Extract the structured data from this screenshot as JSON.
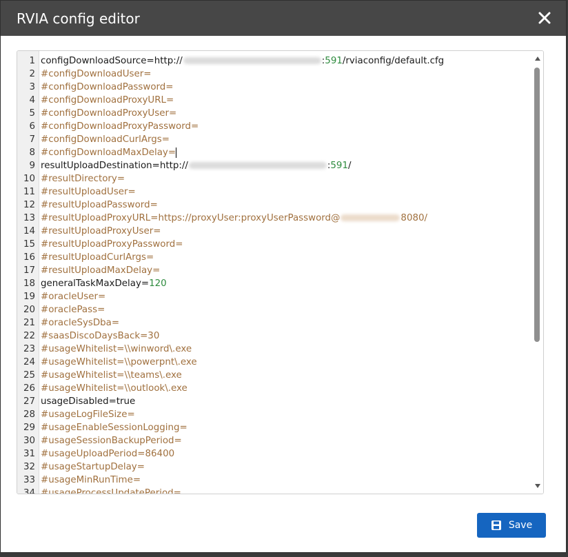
{
  "dialog": {
    "title": "RVIA config editor",
    "close_icon": "close-icon",
    "save_label": "Save",
    "save_icon": "floppy-disk-icon",
    "accent_color": "#1565c0"
  },
  "editor": {
    "lines": [
      {
        "n": "1",
        "parts": [
          {
            "t": "configDownloadSource=http://",
            "c": "plain"
          },
          {
            "t": "",
            "c": "blur"
          },
          {
            "t": ":",
            "c": "plain"
          },
          {
            "t": "591",
            "c": "num"
          },
          {
            "t": "/rviaconfig/default.cfg",
            "c": "plain"
          }
        ]
      },
      {
        "n": "2",
        "parts": [
          {
            "t": "#configDownloadUser=",
            "c": "comment"
          }
        ]
      },
      {
        "n": "3",
        "parts": [
          {
            "t": "#configDownloadPassword=",
            "c": "comment"
          }
        ]
      },
      {
        "n": "4",
        "parts": [
          {
            "t": "#configDownloadProxyURL=",
            "c": "comment"
          }
        ]
      },
      {
        "n": "5",
        "parts": [
          {
            "t": "#configDownloadProxyUser=",
            "c": "comment"
          }
        ]
      },
      {
        "n": "6",
        "parts": [
          {
            "t": "#configDownloadProxyPassword=",
            "c": "comment"
          }
        ]
      },
      {
        "n": "7",
        "parts": [
          {
            "t": "#configDownloadCurlArgs=",
            "c": "comment"
          }
        ]
      },
      {
        "n": "8",
        "parts": [
          {
            "t": "#configDownloadMaxDelay=",
            "c": "comment"
          },
          {
            "t": "",
            "c": "cursor"
          }
        ]
      },
      {
        "n": "9",
        "parts": [
          {
            "t": "resultUploadDestination=http://",
            "c": "plain"
          },
          {
            "t": "",
            "c": "blur"
          },
          {
            "t": ":",
            "c": "plain"
          },
          {
            "t": "591",
            "c": "num"
          },
          {
            "t": "/",
            "c": "plain"
          }
        ]
      },
      {
        "n": "10",
        "parts": [
          {
            "t": "#resultDirectory=",
            "c": "comment"
          }
        ]
      },
      {
        "n": "11",
        "parts": [
          {
            "t": "#resultUploadUser=",
            "c": "comment"
          }
        ]
      },
      {
        "n": "12",
        "parts": [
          {
            "t": "#resultUploadPassword=",
            "c": "comment"
          }
        ]
      },
      {
        "n": "13",
        "parts": [
          {
            "t": "#resultUploadProxyURL=https://proxyUser:proxyUserPassword@",
            "c": "comment"
          },
          {
            "t": "",
            "c": "blur-short"
          },
          {
            "t": "8080/",
            "c": "comment"
          }
        ]
      },
      {
        "n": "14",
        "parts": [
          {
            "t": "#resultUploadProxyUser=",
            "c": "comment"
          }
        ]
      },
      {
        "n": "15",
        "parts": [
          {
            "t": "#resultUploadProxyPassword=",
            "c": "comment"
          }
        ]
      },
      {
        "n": "16",
        "parts": [
          {
            "t": "#resultUploadCurlArgs=",
            "c": "comment"
          }
        ]
      },
      {
        "n": "17",
        "parts": [
          {
            "t": "#resultUploadMaxDelay=",
            "c": "comment"
          }
        ]
      },
      {
        "n": "18",
        "parts": [
          {
            "t": "generalTaskMaxDelay=",
            "c": "plain"
          },
          {
            "t": "120",
            "c": "num"
          }
        ]
      },
      {
        "n": "19",
        "parts": [
          {
            "t": "#oracleUser=",
            "c": "comment"
          }
        ]
      },
      {
        "n": "20",
        "parts": [
          {
            "t": "#oraclePass=",
            "c": "comment"
          }
        ]
      },
      {
        "n": "21",
        "parts": [
          {
            "t": "#oracleSysDba=",
            "c": "comment"
          }
        ]
      },
      {
        "n": "22",
        "parts": [
          {
            "t": "#saasDiscoDaysBack=30",
            "c": "comment"
          }
        ]
      },
      {
        "n": "23",
        "parts": [
          {
            "t": "#usageWhitelist=\\\\winword\\.exe",
            "c": "comment"
          }
        ]
      },
      {
        "n": "24",
        "parts": [
          {
            "t": "#usageWhitelist=\\\\powerpnt\\.exe",
            "c": "comment"
          }
        ]
      },
      {
        "n": "25",
        "parts": [
          {
            "t": "#usageWhitelist=\\\\teams\\.exe",
            "c": "comment"
          }
        ]
      },
      {
        "n": "26",
        "parts": [
          {
            "t": "#usageWhitelist=\\\\outlook\\.exe",
            "c": "comment"
          }
        ]
      },
      {
        "n": "27",
        "parts": [
          {
            "t": "usageDisabled=true",
            "c": "plain"
          }
        ]
      },
      {
        "n": "28",
        "parts": [
          {
            "t": "#usageLogFileSize=",
            "c": "comment"
          }
        ]
      },
      {
        "n": "29",
        "parts": [
          {
            "t": "#usageEnableSessionLogging=",
            "c": "comment"
          }
        ]
      },
      {
        "n": "30",
        "parts": [
          {
            "t": "#usageSessionBackupPeriod=",
            "c": "comment"
          }
        ]
      },
      {
        "n": "31",
        "parts": [
          {
            "t": "#usageUploadPeriod=86400",
            "c": "comment"
          }
        ]
      },
      {
        "n": "32",
        "parts": [
          {
            "t": "#usageStartupDelay=",
            "c": "comment"
          }
        ]
      },
      {
        "n": "33",
        "parts": [
          {
            "t": "#usageMinRunTime=",
            "c": "comment"
          }
        ]
      },
      {
        "n": "34",
        "parts": [
          {
            "t": "#usageProcessUpdatePeriod=",
            "c": "comment"
          }
        ]
      }
    ]
  }
}
